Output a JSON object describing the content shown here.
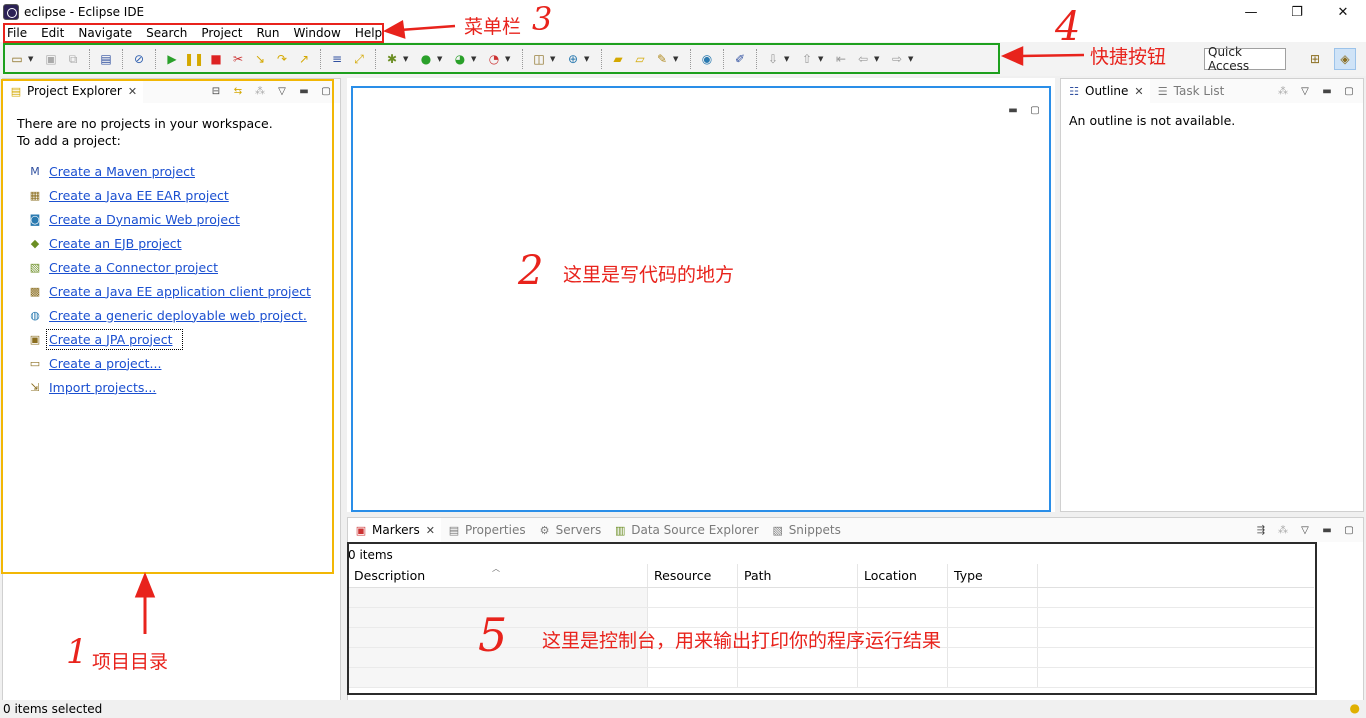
{
  "window": {
    "title": "eclipse - Eclipse IDE",
    "controls": {
      "minimize": "—",
      "restore": "❐",
      "close": "✕"
    }
  },
  "menu": [
    "File",
    "Edit",
    "Navigate",
    "Search",
    "Project",
    "Run",
    "Window",
    "Help"
  ],
  "toolbar": {
    "quick_access": "Quick Access"
  },
  "project_explorer": {
    "tab_label": "Project Explorer",
    "no_projects_line1": "There are no projects in your workspace.",
    "no_projects_line2": "To add a project:",
    "links": [
      {
        "label": "Create a Maven project",
        "icon": "maven-icon"
      },
      {
        "label": "Create a Java EE EAR project",
        "icon": "ear-project-icon"
      },
      {
        "label": "Create a Dynamic Web project",
        "icon": "web-project-icon"
      },
      {
        "label": "Create an EJB project",
        "icon": "ejb-project-icon"
      },
      {
        "label": "Create a Connector project",
        "icon": "connector-project-icon"
      },
      {
        "label": "Create a Java EE application client project",
        "icon": "app-client-icon"
      },
      {
        "label": "Create a generic deployable web project.",
        "icon": "deployable-web-icon"
      },
      {
        "label": "Create a JPA project",
        "icon": "jpa-project-icon"
      },
      {
        "label": "Create a project...",
        "icon": "new-project-icon"
      },
      {
        "label": "Import projects...",
        "icon": "import-icon"
      }
    ]
  },
  "outline": {
    "tabs": [
      "Outline",
      "Task List"
    ],
    "message": "An outline is not available."
  },
  "bottom": {
    "tabs": [
      "Markers",
      "Properties",
      "Servers",
      "Data Source Explorer",
      "Snippets"
    ],
    "items_count": "0 items",
    "columns": [
      "Description",
      "Resource",
      "Path",
      "Location",
      "Type"
    ]
  },
  "status": {
    "text": "0 items selected"
  },
  "annotations": {
    "menu_label": "菜单栏",
    "toolbar_label": "快捷按钮",
    "editor_label": "这里是写代码的地方",
    "console_label": "这里是控制台，用来输出打印你的程序运行结果",
    "explorer_label": "项目目录",
    "n1": "1",
    "n2": "2",
    "n3": "3",
    "n4": "4",
    "n5": "5"
  },
  "colors": {
    "annotation_red": "#e8231c",
    "box_menu": "#e8231c",
    "box_toolbar": "#1ea01e",
    "box_explorer": "#f2b705",
    "box_editor": "#2a8ee8",
    "box_console": "#2b2b2b",
    "link_blue": "#1a4fd0"
  }
}
